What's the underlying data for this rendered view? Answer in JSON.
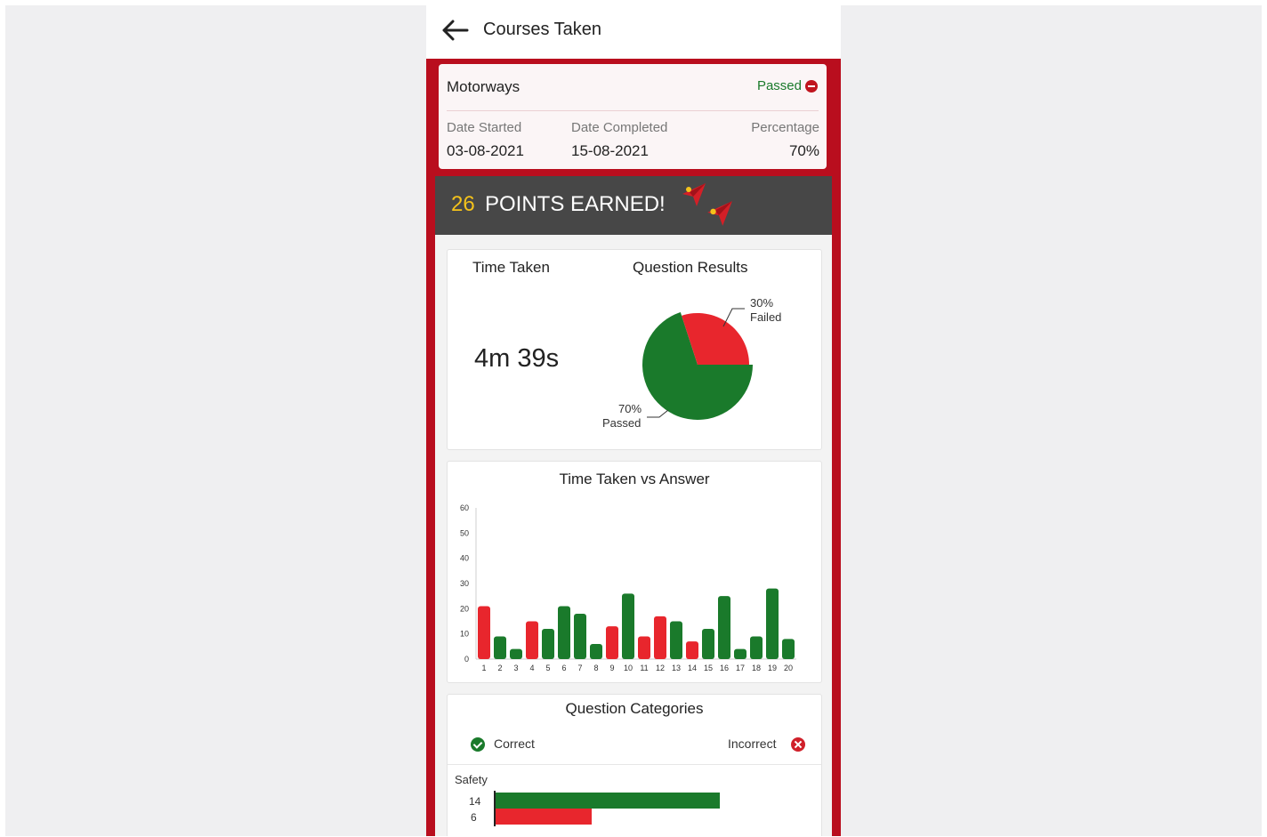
{
  "header": {
    "title": "Courses Taken"
  },
  "course": {
    "name": "Motorways",
    "status": "Passed",
    "date_started_label": "Date Started",
    "date_started": "03-08-2021",
    "date_completed_label": "Date Completed",
    "date_completed": "15-08-2021",
    "percentage_label": "Percentage",
    "percentage": "70%"
  },
  "points": {
    "value": "26",
    "text": "POINTS EARNED!"
  },
  "time_taken": {
    "label": "Time Taken",
    "value": "4m 39s"
  },
  "question_results": {
    "label": "Question Results",
    "failed_pct": "30%",
    "failed_label": "Failed",
    "passed_pct": "70%",
    "passed_label": "Passed"
  },
  "time_vs_answer": {
    "title": "Time Taken vs Answer"
  },
  "categories": {
    "title": "Question Categories",
    "correct_label": "Correct",
    "incorrect_label": "Incorrect",
    "items": [
      {
        "name": "Safety",
        "correct": "14",
        "incorrect": "6"
      }
    ]
  },
  "colors": {
    "brand_red": "#b90e1e",
    "green": "#1a7a2b",
    "red": "#e8262d",
    "banner": "#474747",
    "gold": "#f4c21b"
  },
  "icons": [
    "back-arrow-icon",
    "status-dot-icon",
    "paper-plane-icon",
    "check-circle-icon",
    "x-circle-icon"
  ],
  "chart_data": [
    {
      "type": "pie",
      "title": "Question Results",
      "slices": [
        {
          "name": "Passed",
          "value": 70,
          "color": "#1a7a2b"
        },
        {
          "name": "Failed",
          "value": 30,
          "color": "#e8262d"
        }
      ]
    },
    {
      "type": "bar",
      "title": "Time Taken vs Answer",
      "categories": [
        "1",
        "2",
        "3",
        "4",
        "5",
        "6",
        "7",
        "8",
        "9",
        "10",
        "11",
        "12",
        "13",
        "14",
        "15",
        "16",
        "17",
        "18",
        "19",
        "20"
      ],
      "values": [
        21,
        9,
        4,
        15,
        12,
        21,
        18,
        6,
        13,
        26,
        9,
        17,
        15,
        7,
        12,
        25,
        4,
        9,
        28,
        8
      ],
      "bar_colors": [
        "red",
        "green",
        "green",
        "red",
        "green",
        "green",
        "green",
        "green",
        "red",
        "green",
        "red",
        "red",
        "green",
        "red",
        "green",
        "green",
        "green",
        "green",
        "green",
        "green"
      ],
      "yticks": [
        0,
        10,
        20,
        30,
        40,
        50,
        60
      ],
      "ylim": [
        0,
        60
      ],
      "xlabel": "",
      "ylabel": ""
    },
    {
      "type": "bar",
      "orientation": "horizontal",
      "title": "Question Categories",
      "categories": [
        "Safety"
      ],
      "series": [
        {
          "name": "Correct",
          "values": [
            14
          ],
          "color": "#1a7a2b"
        },
        {
          "name": "Incorrect",
          "values": [
            6
          ],
          "color": "#e8262d"
        }
      ]
    }
  ]
}
